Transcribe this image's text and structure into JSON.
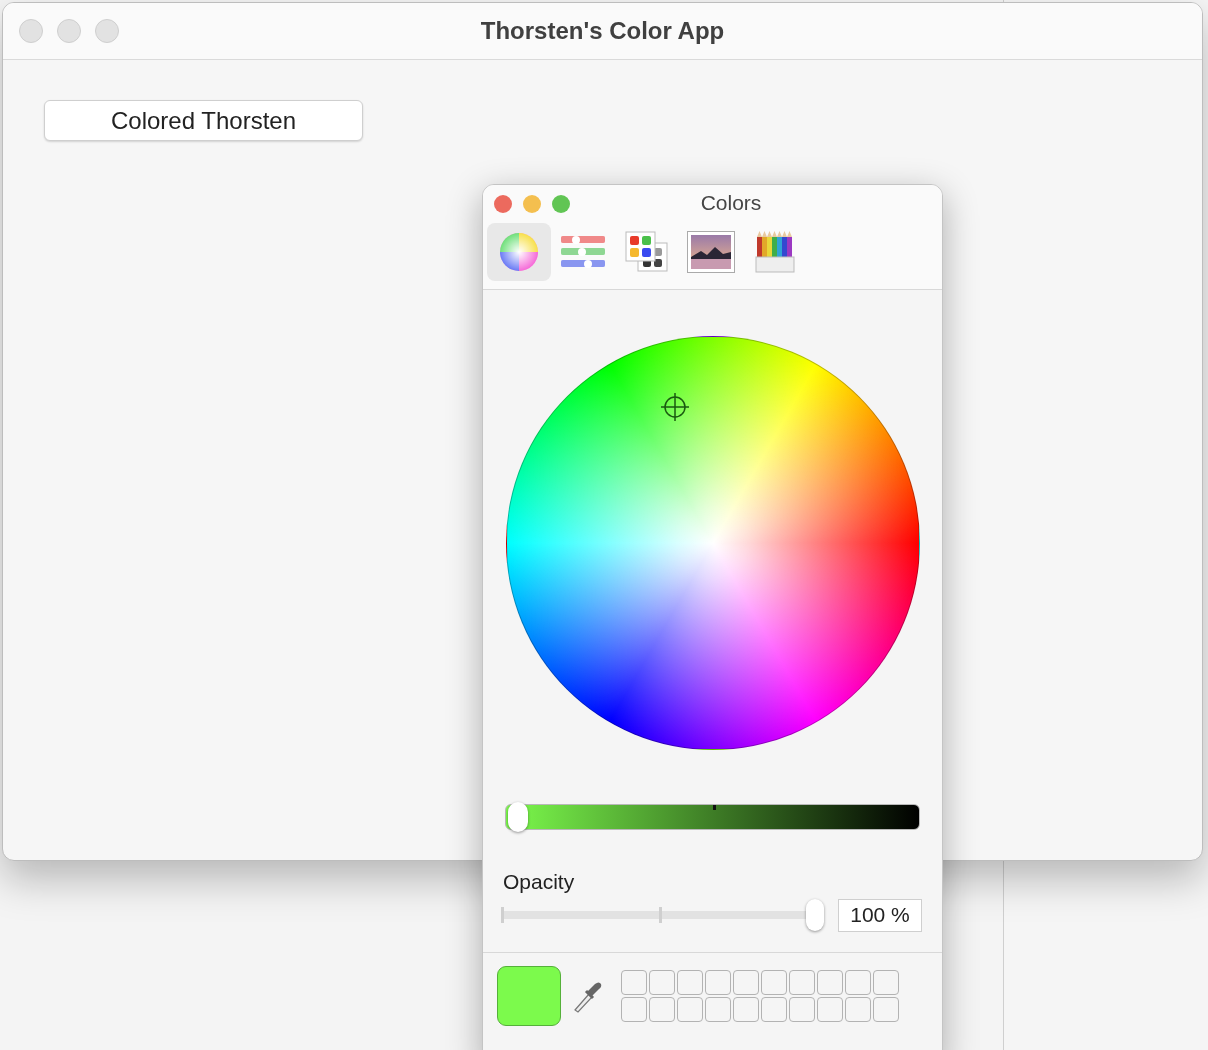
{
  "window": {
    "title": "Thorsten's Color App"
  },
  "button": {
    "label": "Colored Thorsten"
  },
  "color_panel": {
    "title": "Colors",
    "modes": [
      {
        "kind": "wheel",
        "selected": true
      },
      {
        "kind": "sliders",
        "selected": false
      },
      {
        "kind": "palettes",
        "selected": false
      },
      {
        "kind": "image",
        "selected": false
      },
      {
        "kind": "pencils",
        "selected": false
      }
    ],
    "brightness": {
      "level": 0.03
    },
    "opacity": {
      "label": "Opacity",
      "level": 1,
      "value": "100 %"
    },
    "current_color": {
      "color": "#7cfa4c"
    }
  }
}
